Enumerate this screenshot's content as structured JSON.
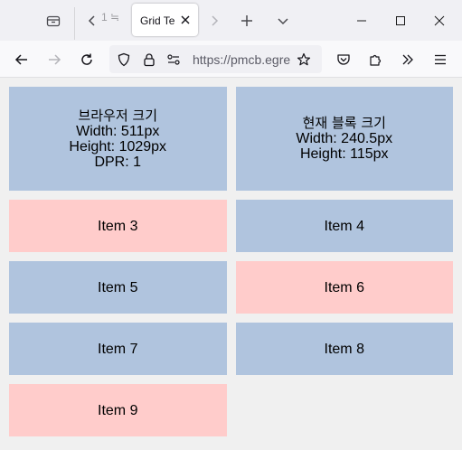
{
  "browser": {
    "tabs": [
      {
        "label": "1 ≒",
        "partial": true
      },
      {
        "label": "Grid Te",
        "active": true
      }
    ],
    "url_display": "https://pmcb.egre",
    "icons": {
      "tab_overview": "tab-overview-icon",
      "scroll_left": "chevron-left-icon",
      "close_tab": "close-icon",
      "scroll_right": "chevron-right-icon",
      "new_tab": "plus-icon",
      "tab_list": "chevron-down-icon",
      "minimize": "minimize-icon",
      "maximize": "maximize-icon",
      "close_window": "close-icon",
      "back": "arrow-left-icon",
      "forward": "arrow-right-icon",
      "reload": "reload-icon",
      "shield": "shield-icon",
      "lock": "lock-icon",
      "permissions": "permissions-icon",
      "bookmark": "star-icon",
      "pocket": "pocket-icon",
      "extensions": "puzzle-icon",
      "overflow": "double-chevron-icon",
      "menu": "hamburger-icon"
    }
  },
  "page": {
    "browser_size": {
      "title": "브라우저 크기",
      "width": "Width: 511px",
      "height": "Height: 1029px",
      "dpr": "DPR: 1"
    },
    "block_size": {
      "title": "현재 블록 크기",
      "width": "Width: 240.5px",
      "height": "Height: 115px"
    },
    "items": [
      {
        "label": "Item 3",
        "color": "pink"
      },
      {
        "label": "Item 4",
        "color": "blue"
      },
      {
        "label": "Item 5",
        "color": "blue"
      },
      {
        "label": "Item 6",
        "color": "pink"
      },
      {
        "label": "Item 7",
        "color": "blue"
      },
      {
        "label": "Item 8",
        "color": "blue"
      },
      {
        "label": "Item 9",
        "color": "pink"
      }
    ]
  },
  "colors": {
    "blue": "#b0c4de",
    "pink": "#ffcccb",
    "page_background": "#f0f0f0"
  }
}
